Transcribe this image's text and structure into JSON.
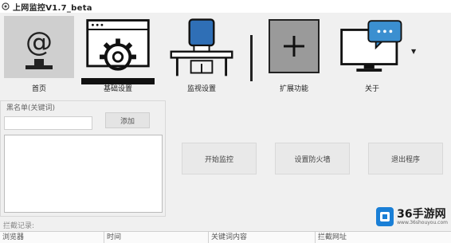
{
  "window": {
    "title": "上网监控V1.7_beta"
  },
  "toolbar": {
    "items": [
      {
        "label": "首页",
        "icon": "at-monitor-icon"
      },
      {
        "label": "基础设置",
        "icon": "gear-window-icon"
      },
      {
        "label": "监视设置",
        "icon": "chair-desk-icon"
      },
      {
        "label": "扩展功能",
        "icon": "plus-box-icon"
      },
      {
        "label": "关于",
        "icon": "chat-monitor-icon"
      }
    ]
  },
  "keywords": {
    "group_title": "黑名单(关键词)",
    "input_value": "",
    "add_label": "添加",
    "list": []
  },
  "actions": {
    "start_label": "开始监控",
    "firewall_label": "设置防火墙",
    "exit_label": "退出程序"
  },
  "log": {
    "label": "拦截记录:",
    "columns": [
      "浏览器",
      "时间",
      "关键词内容",
      "拦截网址"
    ]
  },
  "watermark": {
    "main": "36手游网",
    "sub": "www.36shouyou.com"
  },
  "colors": {
    "accent": "#1a7fd6",
    "chat_blue": "#3b8fd0",
    "chair_blue": "#2f6fb6"
  }
}
